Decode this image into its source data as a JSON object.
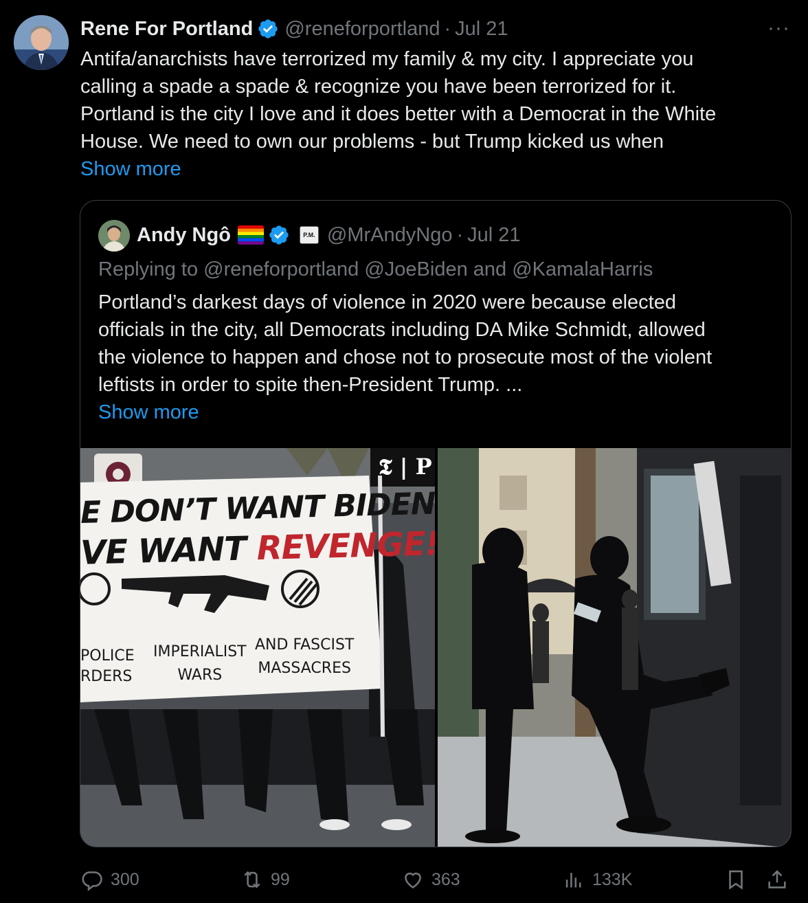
{
  "tweet": {
    "author_name": "Rene For Portland",
    "handle": "@reneforportland",
    "separator": "·",
    "date": "Jul 21",
    "more_label": "···",
    "text_lines": [
      "Antifa/anarchists have terrorized my family & my city.  I appreciate you",
      "calling a spade a spade & recognize you have been terrorized for it.",
      "Portland is the city I love and it does better with a Democrat in the White",
      "House. We need to own our problems - but Trump kicked us when"
    ],
    "show_more": "Show more"
  },
  "quoted": {
    "author_name": "Andy Ngô",
    "affiliate_badge": "P.M.",
    "handle": "@MrAndyNgo",
    "separator": "·",
    "date": "Jul 21",
    "reply_prefix": "Replying to",
    "reply_to_1": "@reneforportland",
    "reply_to_2": "@JoeBiden",
    "reply_and": "and",
    "reply_to_3": "@KamalaHarris",
    "text_lines": [
      "Portland’s darkest days of violence in 2020 were because elected",
      "officials in the city, all Democrats including DA Mike Schmidt, allowed",
      "the violence to happen and chose not to prosecute most of the violent",
      "leftists in order to spite then-President Trump. ..."
    ],
    "show_more": "Show more",
    "media": {
      "left": {
        "banner_line1": "E DON’T WANT BIDEN–",
        "banner_line2_a": "VE WANT ",
        "banner_line2_b": "REVENGE!",
        "col1_a": "POLICE",
        "col1_b": "RDERS",
        "col2_a": "IMPERIALIST",
        "col2_b": "WARS",
        "col3_a": "AND FASCIST",
        "col3_b": "MASSACRES",
        "watermark": "𝕿 | P"
      }
    }
  },
  "actions": {
    "replies": "300",
    "reposts": "99",
    "likes": "363",
    "views": "133K"
  },
  "colors": {
    "background": "#000000",
    "text": "#e7e9ea",
    "muted": "#71767b",
    "link": "#1d9bf0",
    "verified": "#1d9bf0",
    "revenge_red": "#c0262d"
  }
}
